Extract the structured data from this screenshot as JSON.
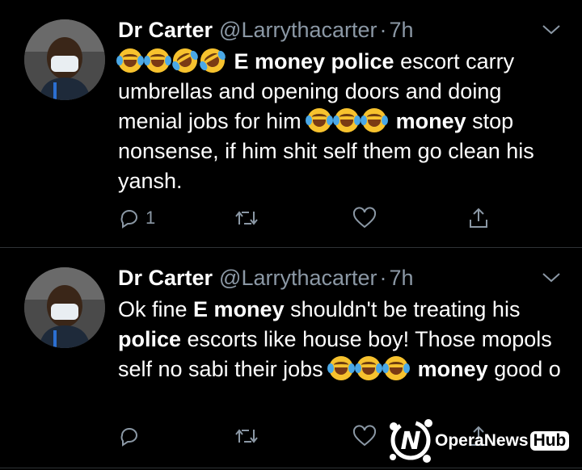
{
  "tweets": [
    {
      "name": "Dr Carter",
      "handle": "@Larrythacarter",
      "time": "7h",
      "text_parts": [
        {
          "t": "E money police",
          "bold": true
        },
        {
          "t": " escort carry umbrellas and opening doors and doing menial jobs for him ",
          "bold": false
        },
        {
          "t": "money",
          "bold": true
        },
        {
          "t": " stop nonsense, if him shit self them go clean his yansh.",
          "bold": false
        }
      ],
      "reply_count": "1"
    },
    {
      "name": "Dr Carter",
      "handle": "@Larrythacarter",
      "time": "7h",
      "text_parts": [
        {
          "t": "Ok fine ",
          "bold": false
        },
        {
          "t": "E money",
          "bold": true
        },
        {
          "t": " shouldn't be treating his ",
          "bold": false
        },
        {
          "t": "police",
          "bold": true
        },
        {
          "t": " escorts like house boy! Those mopols self no sabi their jobs ",
          "bold": false
        },
        {
          "t": "money",
          "bold": true
        },
        {
          "t": " good o",
          "bold": false
        }
      ],
      "reply_count": ""
    }
  ],
  "watermark": {
    "brand": "OperaNews",
    "hub": "Hub"
  },
  "colors": {
    "background": "#000000",
    "muted": "#8b98a5",
    "divider": "#2f3336"
  },
  "icons": [
    "chevron-down-icon",
    "reply-icon",
    "retweet-icon",
    "like-icon",
    "share-icon",
    "face-with-tears-of-joy-emoji",
    "rofl-emoji"
  ]
}
